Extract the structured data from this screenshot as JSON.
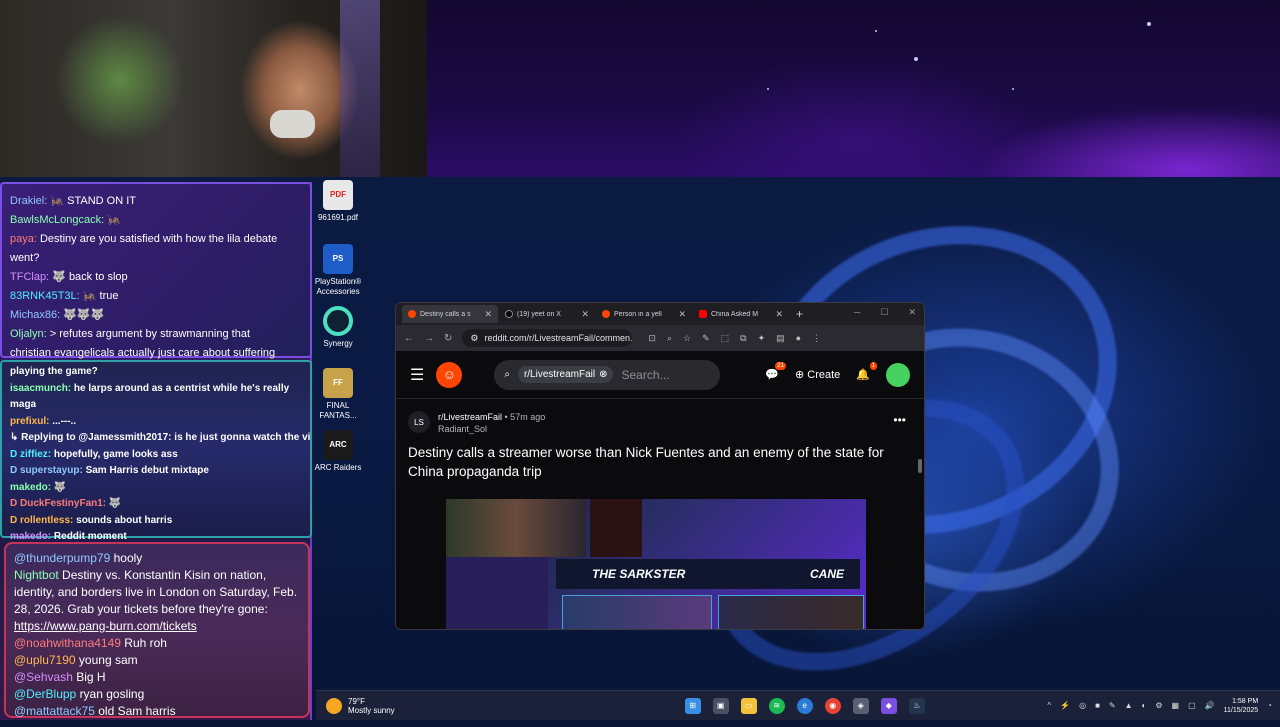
{
  "chat_top": [
    {
      "user": "Drakiel:",
      "msg": "🦗 STAND ON IT"
    },
    {
      "user": "BawlsMcLongcack:",
      "msg": "🦗"
    },
    {
      "user": "paya:",
      "msg": "Destiny are you satisfied with how the lila debate"
    },
    {
      "user": "",
      "msg": "went?"
    },
    {
      "user": "TFClap:",
      "msg": "🐺 back to slop"
    },
    {
      "user": "83RNK45T3L:",
      "msg": "🦗 true"
    },
    {
      "user": "Michax86:",
      "msg": "🐺🐺🐺"
    },
    {
      "user": "Oljalyn:",
      "msg": "> refutes argument by strawmanning that"
    },
    {
      "user": "",
      "msg": "christian evangelicals actually just care about suffering"
    }
  ],
  "chat_mid": [
    {
      "user": "",
      "msg": "playing the game?"
    },
    {
      "user": "isaacmunch:",
      "msg": "he larps around as a centrist while he's really"
    },
    {
      "user": "",
      "msg": "maga"
    },
    {
      "user": "prefixul:",
      "msg": "...---.."
    },
    {
      "user": "",
      "msg": "↳ Replying to @Jamessmith2017: is he just gonna watch the vids instead of pl..."
    },
    {
      "user": "D ziffiez:",
      "msg": "hopefully, game looks ass"
    },
    {
      "user": "D superstayup:",
      "msg": "Sam Harris debut mixtape"
    },
    {
      "user": "makedo:",
      "msg": "🐺"
    },
    {
      "user": "D DuckFestinyFan1:",
      "msg": "🐺"
    },
    {
      "user": "D rollentless:",
      "msg": "sounds about harris"
    },
    {
      "user": "makedo:",
      "msg": "Reddit moment"
    }
  ],
  "chat_bot": [
    {
      "user": "@thunderpump79",
      "msg": "hooly"
    },
    {
      "user": "Nightbot",
      "msg": "Destiny vs. Konstantin Kisin on nation, identity, and borders live in London on Saturday, Feb. 28, 2026. Grab your tickets before they're gone:",
      "link": "https://www.pang-burn.com/tickets"
    },
    {
      "user": "@noahwithana4149",
      "msg": "Ruh roh"
    },
    {
      "user": "@uplu7190",
      "msg": "young sam"
    },
    {
      "user": "@Sehvash",
      "msg": "Big H"
    },
    {
      "user": "@DerBlupp",
      "msg": "ryan gosling"
    },
    {
      "user": "@mattattack75",
      "msg": "old Sam harris"
    }
  ],
  "desktop_icons": [
    {
      "label": "961691.pdf",
      "icon": "pdf-icon",
      "img": "PDF"
    },
    {
      "label": "PlayStation® Accessories",
      "icon": "playstation-icon",
      "img": "PS"
    },
    {
      "label": "Synergy",
      "icon": "synergy-icon",
      "img": ""
    },
    {
      "label": "FINAL FANTAS...",
      "icon": "final-fantasy-icon",
      "img": "FF"
    },
    {
      "label": "ARC Raiders",
      "icon": "arc-raiders-icon",
      "img": "ARC"
    }
  ],
  "browser": {
    "tabs": [
      {
        "title": "Destiny calls a s",
        "fav": "reddit"
      },
      {
        "title": "(19) yeet on X",
        "fav": "x"
      },
      {
        "title": "Person in a yell",
        "fav": "reddit"
      },
      {
        "title": "China Asked M",
        "fav": "youtube"
      }
    ],
    "url": "reddit.com/r/LivestreamFail/commen...",
    "search_chip": "r/LivestreamFail",
    "search_placeholder": "Search...",
    "create_label": "Create",
    "chat_badge": "21",
    "notif_badge": "1",
    "post": {
      "subreddit": "r/LivestreamFail",
      "time": "• 57m ago",
      "author": "Radiant_Sol",
      "sub_icon_text": "LS",
      "title": "Destiny calls a streamer worse than Nick Fuentes and an enemy of the state for China propaganda trip",
      "thumb_left": "THE SARKSTER",
      "thumb_right": "CANE"
    }
  },
  "taskbar": {
    "temp": "79°F",
    "weather": "Mostly sunny",
    "time": "1:58 PM",
    "date": "11/15/2025"
  }
}
